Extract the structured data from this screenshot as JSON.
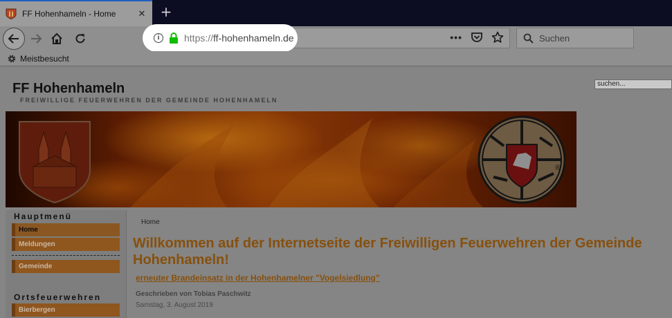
{
  "browser": {
    "tab": {
      "title": "FF Hohenhameln - Home"
    },
    "url": {
      "scheme": "https://",
      "host": "ff-hohenhameln.de"
    },
    "search": {
      "placeholder": "Suchen"
    },
    "bookmarks": [
      {
        "label": "Meistbesucht"
      }
    ]
  },
  "site": {
    "title": "FF Hohenhameln",
    "subtitle": "FREIWILLIGE FEUERWEHREN DER GEMEINDE HOHENHAMELN",
    "search_value": "suchen..."
  },
  "sidebar": {
    "main_heading": "Hauptmenü",
    "main_items": [
      {
        "label": "Home",
        "active": true
      },
      {
        "label": "Meldungen",
        "active": false
      },
      {
        "label": "Gemeinde",
        "active": false
      }
    ],
    "local_heading": "Ortsfeuerwehren",
    "local_items": [
      {
        "label": "Bierbergen"
      }
    ]
  },
  "content": {
    "breadcrumb": "Home",
    "welcome": "Willkommen auf der Internetseite der Freiwilligen Feuerwehren der Gemeinde Hohenhameln!",
    "article_title": "erneuter Brandeinsatz in der Hohenhamelner \"Vogelsiedlung\"",
    "article_author": "Geschrieben von Tobias Paschwitz",
    "article_date": "Samstag, 3. August 2019"
  },
  "colors": {
    "accent_orange": "#87500e",
    "menu_bg": "#8f561e",
    "tab_accent": "#1f5fbf",
    "lock_green": "#12bc00"
  },
  "icons": [
    "favicon-icon",
    "close-icon",
    "plus-icon",
    "back-arrow-icon",
    "forward-arrow-icon",
    "home-icon",
    "reload-icon",
    "info-icon",
    "lock-icon",
    "more-dots-icon",
    "pocket-icon",
    "star-icon",
    "search-icon",
    "gear-icon",
    "coat-of-arms-icon",
    "fire-brigade-emblem-icon"
  ]
}
